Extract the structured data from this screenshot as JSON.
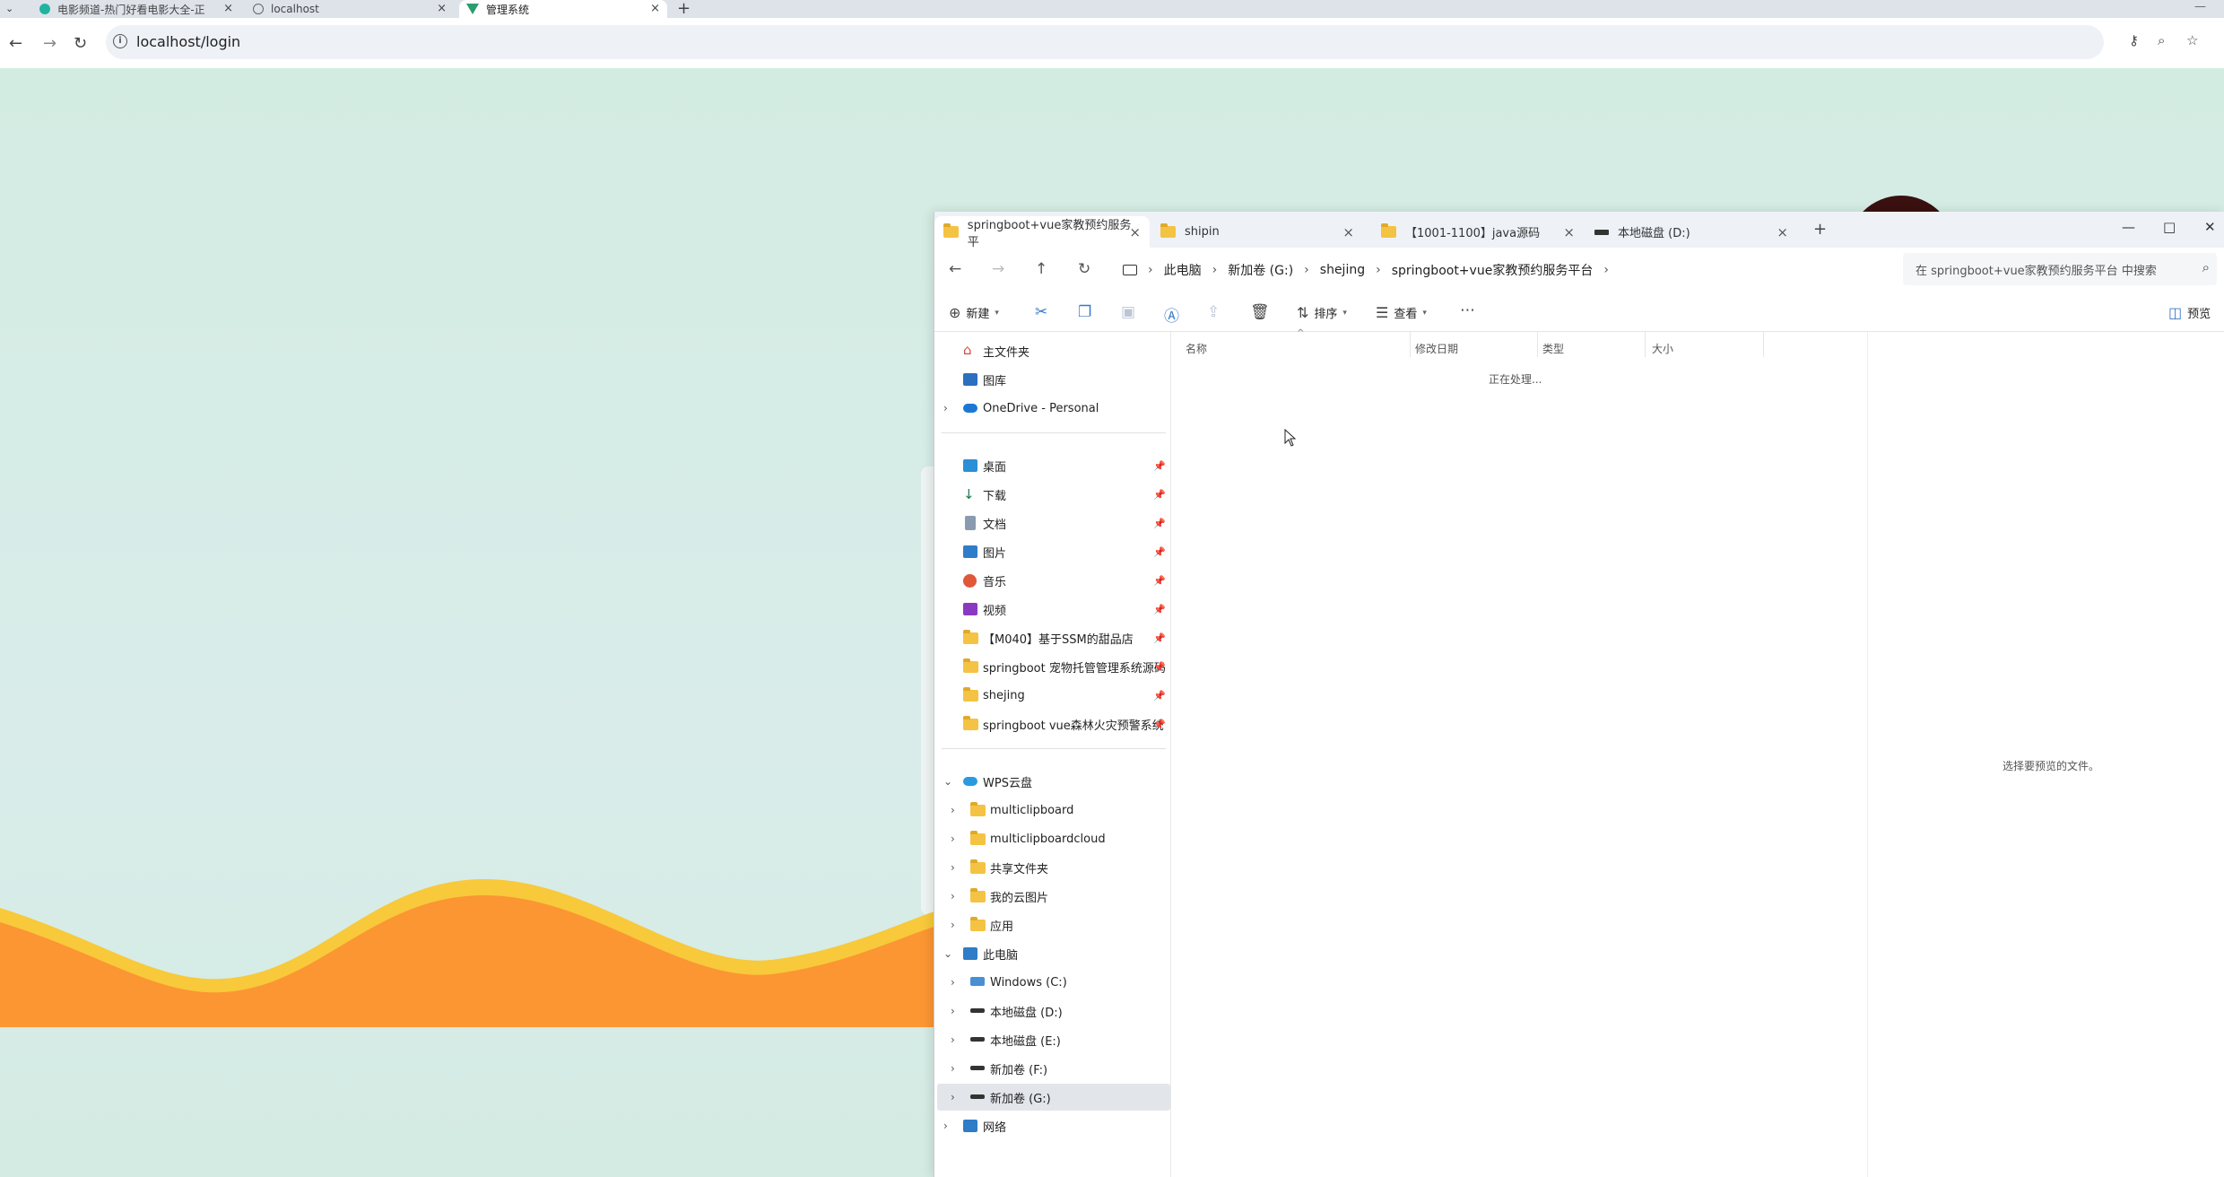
{
  "browser": {
    "tabs": [
      {
        "label": "电影频道-热门好看电影大全-正",
        "active": false
      },
      {
        "label": "localhost",
        "active": false
      },
      {
        "label": "管理系统",
        "active": true
      }
    ],
    "url": "localhost/login"
  },
  "explorer": {
    "tabs": [
      {
        "label": "springboot+vue家教预约服务平",
        "active": true
      },
      {
        "label": "shipin",
        "active": false
      },
      {
        "label": "【1001-1100】java源码",
        "active": false
      },
      {
        "label": "本地磁盘 (D:)",
        "active": false
      }
    ],
    "breadcrumb": [
      "此电脑",
      "新加卷 (G:)",
      "shejing",
      "springboot+vue家教预约服务平台"
    ],
    "search_placeholder": "在 springboot+vue家教预约服务平台 中搜索",
    "commands": {
      "new": "新建",
      "sort": "排序",
      "view": "查看",
      "preview": "预览"
    },
    "nav": {
      "home": "主文件夹",
      "gallery": "图库",
      "onedrive": "OneDrive - Personal",
      "quick_access": [
        {
          "label": "桌面",
          "icon": "desktop-icon"
        },
        {
          "label": "下载",
          "icon": "download-icon"
        },
        {
          "label": "文档",
          "icon": "document-icon"
        },
        {
          "label": "图片",
          "icon": "pictures-icon"
        },
        {
          "label": "音乐",
          "icon": "music-icon"
        },
        {
          "label": "视频",
          "icon": "video-icon"
        },
        {
          "label": "【M040】基于SSM的甜品店",
          "icon": "folder-icon"
        },
        {
          "label": "springboot 宠物托管管理系统源码",
          "icon": "folder-icon"
        },
        {
          "label": "shejing",
          "icon": "folder-icon"
        },
        {
          "label": "springboot vue森林火灾预警系统",
          "icon": "folder-icon"
        }
      ],
      "wps": "WPS云盘",
      "wps_children": [
        "multiclipboard",
        "multiclipboardcloud",
        "共享文件夹",
        "我的云图片",
        "应用"
      ],
      "this_pc": "此电脑",
      "drives": [
        "Windows (C:)",
        "本地磁盘 (D:)",
        "本地磁盘 (E:)",
        "新加卷 (F:)",
        "新加卷 (G:)"
      ],
      "network": "网络"
    },
    "columns": [
      "名称",
      "修改日期",
      "类型",
      "大小"
    ],
    "status": "正在处理...",
    "preview_message": "选择要预览的文件。"
  }
}
